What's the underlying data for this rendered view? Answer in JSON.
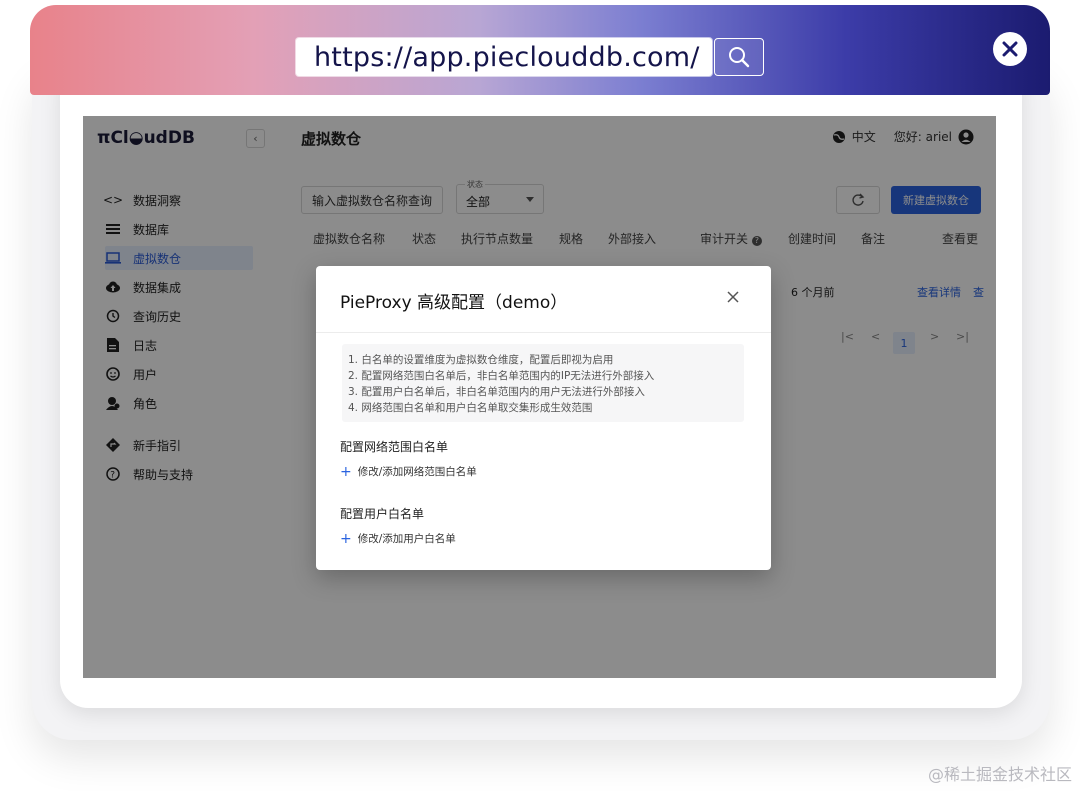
{
  "browser": {
    "url": "https://app.pieclouddb.com/",
    "search_icon": "magnifier-icon",
    "close_icon": "close-circle-icon"
  },
  "app": {
    "logo": "πCl◒udDB",
    "collapse_label": "‹",
    "page_title": "虚拟数仓",
    "language": "中文",
    "greeting": "您好: ariel",
    "sidebar": {
      "items": [
        {
          "label": "数据洞察",
          "icon": "code-icon"
        },
        {
          "label": "数据库",
          "icon": "list-icon"
        },
        {
          "label": "虚拟数仓",
          "icon": "laptop-icon",
          "active": true
        },
        {
          "label": "数据集成",
          "icon": "cloud-upload-icon"
        },
        {
          "label": "查询历史",
          "icon": "history-icon"
        },
        {
          "label": "日志",
          "icon": "file-icon"
        },
        {
          "label": "用户",
          "icon": "user-face-icon"
        },
        {
          "label": "角色",
          "icon": "roles-icon"
        },
        {
          "label": "新手指引",
          "icon": "guide-icon"
        },
        {
          "label": "帮助与支持",
          "icon": "help-icon"
        }
      ]
    },
    "toolbar": {
      "search_placeholder": "输入虚拟数仓名称查询",
      "status_label": "状态",
      "status_value": "全部",
      "new_button": "新建虚拟数仓"
    },
    "table": {
      "headers": [
        "虚拟数仓名称",
        "状态",
        "执行节点数量",
        "规格",
        "外部接入",
        "审计开关",
        "创建时间",
        "备注",
        "查看更"
      ],
      "row": {
        "created": "6 个月前",
        "detail_link": "查看详情",
        "more_link": "查"
      }
    },
    "pagination": {
      "current_page": "1"
    }
  },
  "modal": {
    "title": "PieProxy 高级配置（demo）",
    "notes": [
      "1. 白名单的设置维度为虚拟数仓维度，配置后即视为启用",
      "2. 配置网络范围白名单后，非白名单范围内的IP无法进行外部接入",
      "3. 配置用户白名单后，非白名单范围内的用户无法进行外部接入",
      "4. 网络范围白名单和用户白名单取交集形成生效范围"
    ],
    "network_section": "配置网络范围白名单",
    "network_add": "修改/添加网络范围白名单",
    "user_section": "配置用户白名单",
    "user_add": "修改/添加用户白名单"
  },
  "watermark": "@稀土掘金技术社区",
  "colors": {
    "primary": "#2a63e0",
    "overlay": "rgba(0,0,0,0.45)"
  }
}
